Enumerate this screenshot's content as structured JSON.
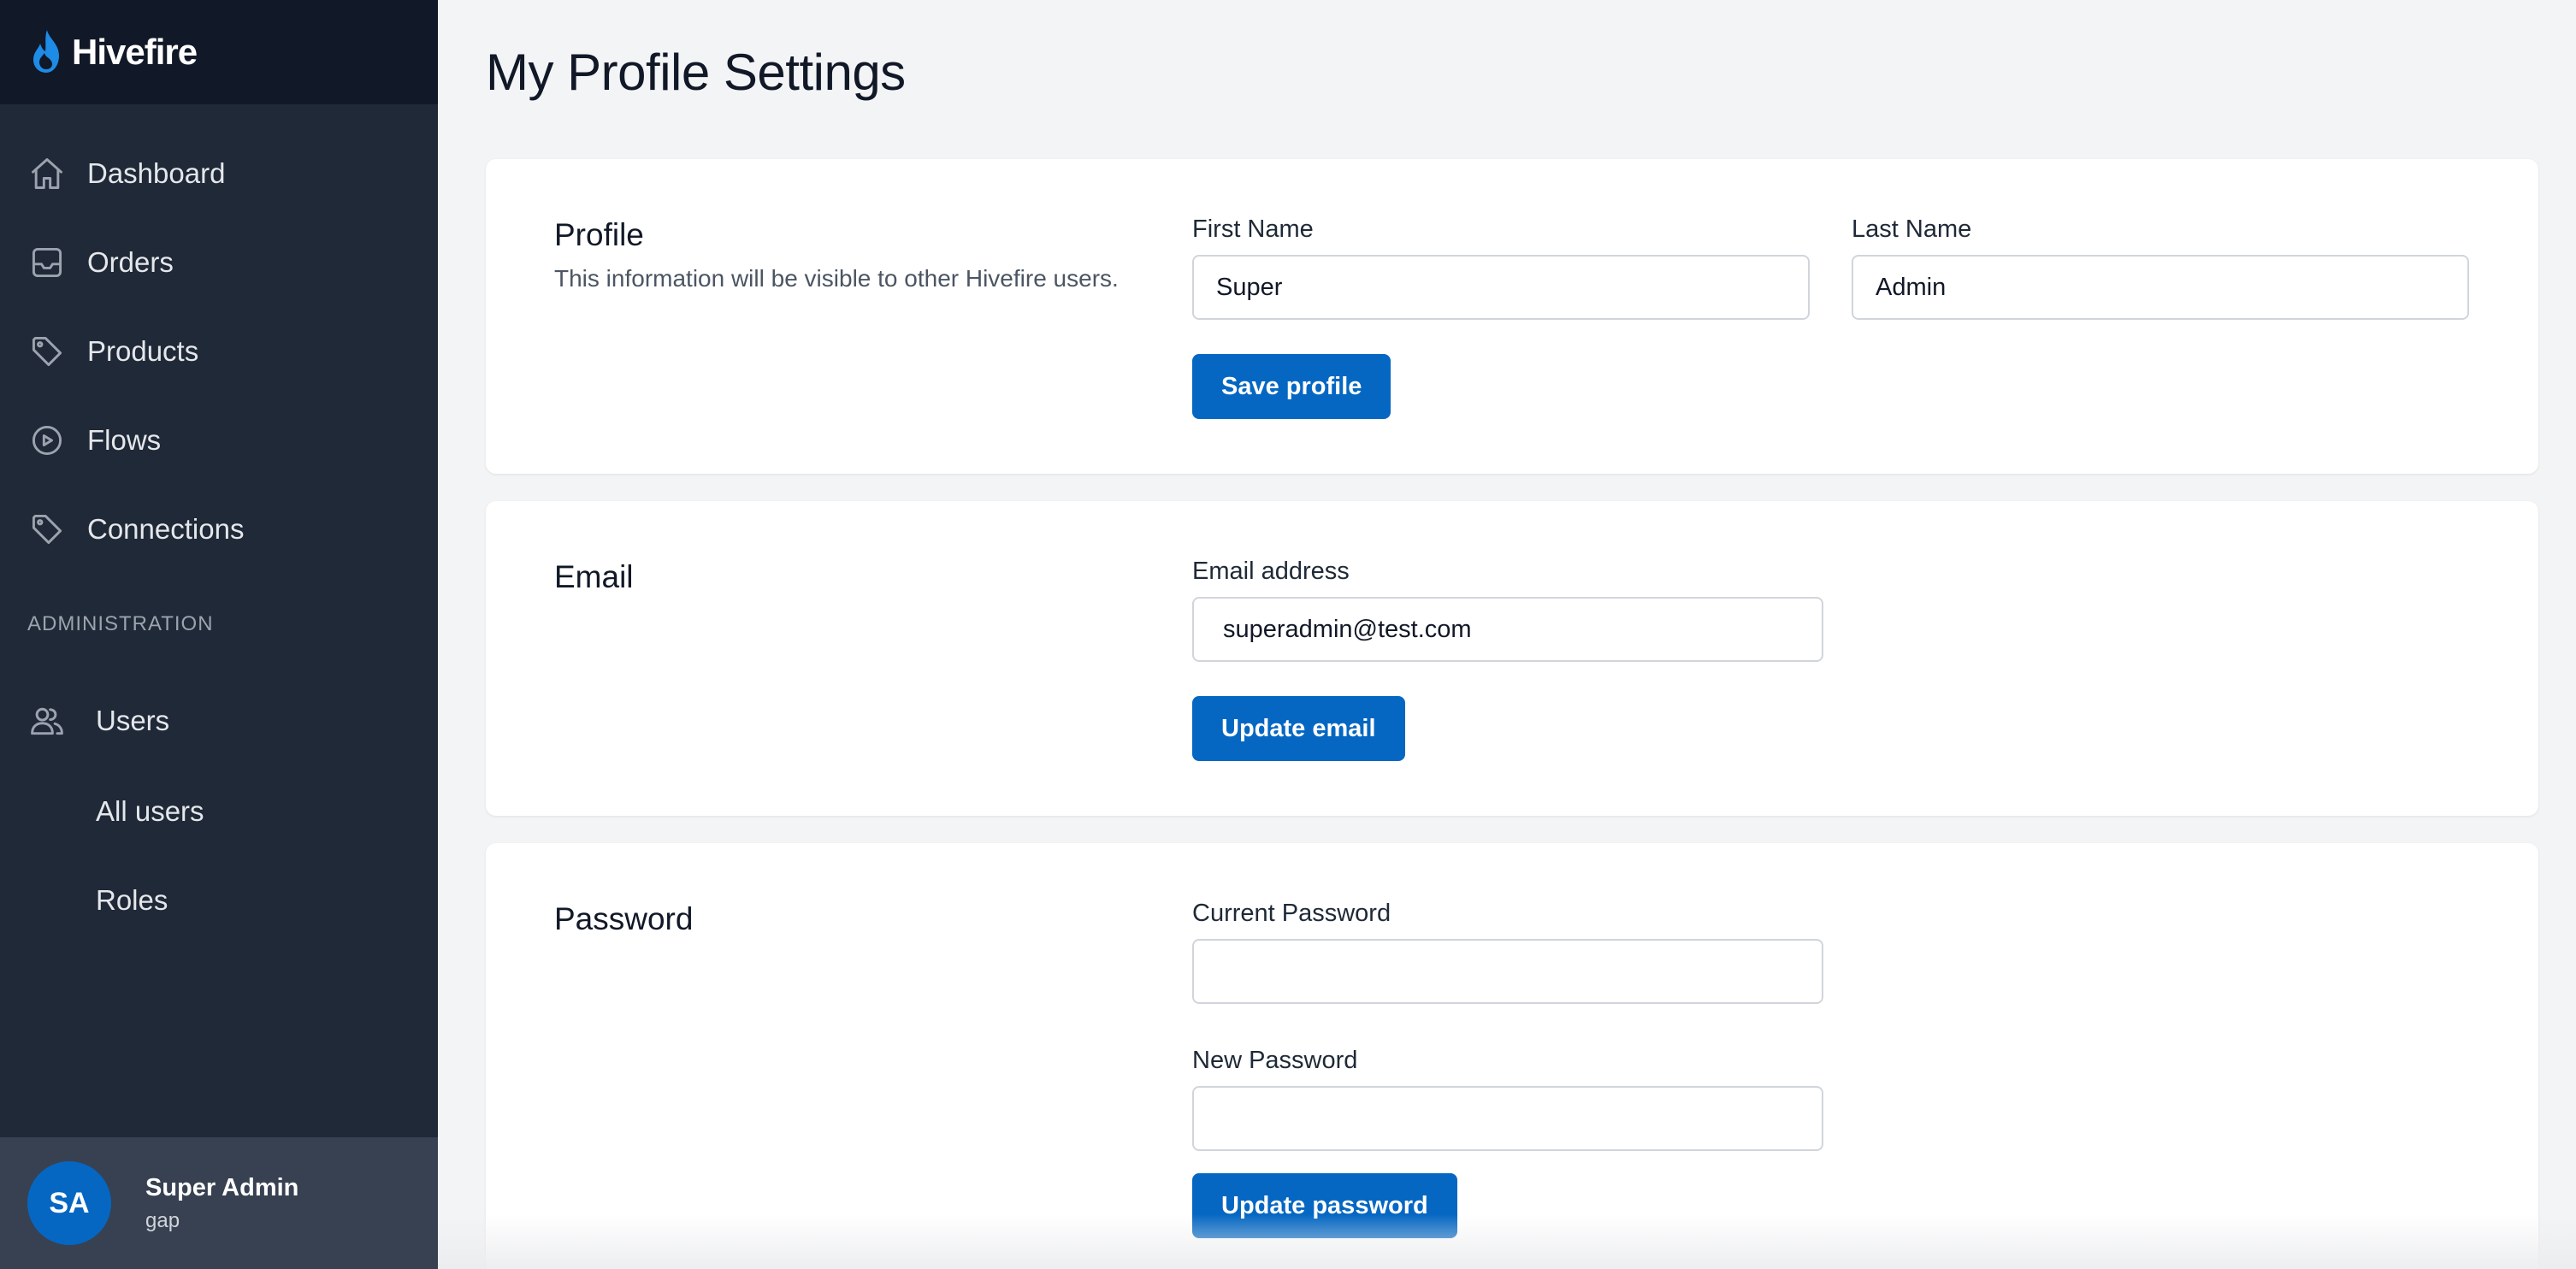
{
  "brand": {
    "name": "Hivefire",
    "icon": "flame-icon"
  },
  "sidebar": {
    "items": [
      {
        "label": "Dashboard",
        "icon": "home-icon"
      },
      {
        "label": "Orders",
        "icon": "inbox-icon"
      },
      {
        "label": "Products",
        "icon": "tag-icon"
      },
      {
        "label": "Flows",
        "icon": "play-circle-icon"
      },
      {
        "label": "Connections",
        "icon": "tag-icon"
      }
    ],
    "section_label": "ADMINISTRATION",
    "admin": {
      "users_label": "Users",
      "users_icon": "users-icon",
      "sub_items": [
        "All users",
        "Roles"
      ]
    },
    "user": {
      "initials": "SA",
      "name": "Super Admin",
      "subtitle": "gap"
    }
  },
  "page": {
    "title": "My Profile Settings"
  },
  "profile": {
    "title": "Profile",
    "description": "This information will be visible to other Hivefire users.",
    "first_name_label": "First Name",
    "first_name_value": "Super",
    "last_name_label": "Last Name",
    "last_name_value": "Admin",
    "save_label": "Save profile"
  },
  "email": {
    "title": "Email",
    "address_label": "Email address",
    "address_value": "superadmin@test.com",
    "update_label": "Update email"
  },
  "password": {
    "title": "Password",
    "current_label": "Current Password",
    "current_value": "",
    "new_label": "New Password",
    "new_value": "",
    "update_label": "Update password"
  },
  "colors": {
    "sidebar_bg": "#1f2937",
    "brand_bg": "#111827",
    "primary": "#0567c2",
    "page_bg": "#f3f4f6"
  }
}
